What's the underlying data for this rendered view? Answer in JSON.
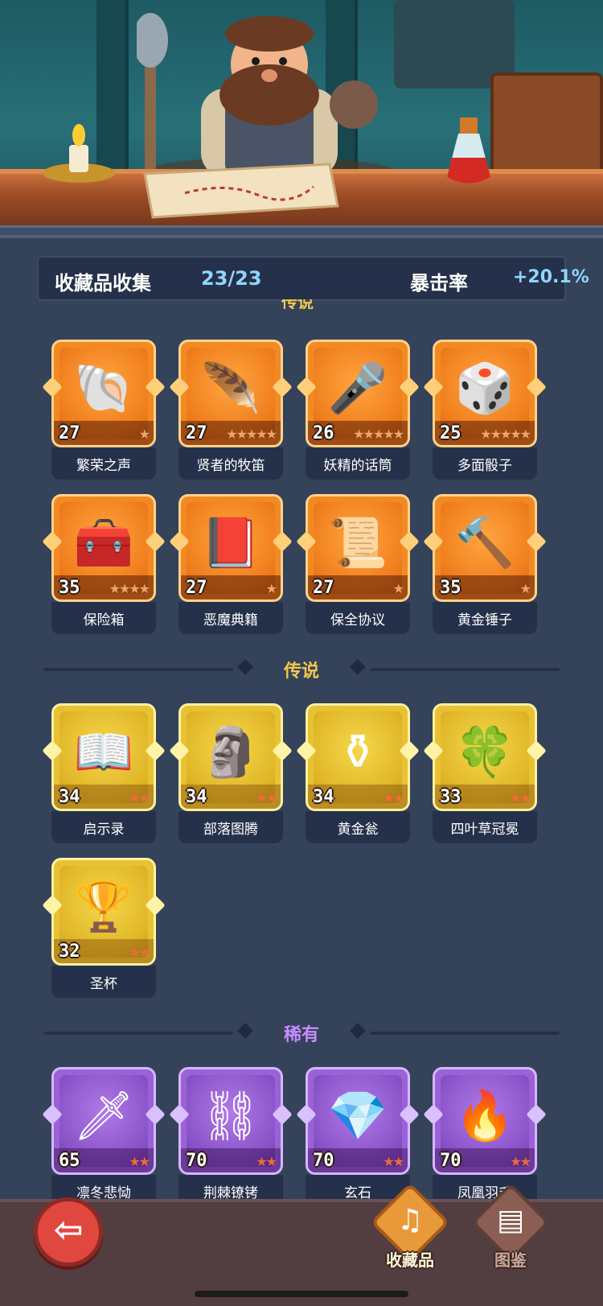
{
  "header": {
    "collection_label": "收藏品收集",
    "collection_count": "23/23",
    "crit_label": "暴击率",
    "crit_value": "+20.1%",
    "cut_section_title": "传说"
  },
  "sections": [
    {
      "title": "",
      "tier": "orange",
      "items": [
        {
          "name": "繁荣之声",
          "level": "27",
          "stars": "★",
          "icon": "shell-icon"
        },
        {
          "name": "贤者的牧笛",
          "level": "27",
          "stars": "★★★★★",
          "icon": "flute-icon"
        },
        {
          "name": "妖精的话筒",
          "level": "26",
          "stars": "★★★★★",
          "icon": "microphone-icon"
        },
        {
          "name": "多面骰子",
          "level": "25",
          "stars": "★★★★★",
          "icon": "dice-icon"
        },
        {
          "name": "保险箱",
          "level": "35",
          "stars": "★★★★",
          "icon": "treasure-chest-icon"
        },
        {
          "name": "恶魔典籍",
          "level": "27",
          "stars": "★",
          "icon": "demon-book-icon"
        },
        {
          "name": "保全协议",
          "level": "27",
          "stars": "★",
          "icon": "contract-icon"
        },
        {
          "name": "黄金锤子",
          "level": "35",
          "stars": "★",
          "icon": "hammer-icon"
        }
      ]
    },
    {
      "title": "传说",
      "title_color": "#f2c94c",
      "tier": "gold",
      "items": [
        {
          "name": "启示录",
          "level": "34",
          "stars": "★★",
          "icon": "open-book-icon"
        },
        {
          "name": "部落图腾",
          "level": "34",
          "stars": "★★",
          "icon": "totem-icon"
        },
        {
          "name": "黄金瓮",
          "level": "34",
          "stars": "★★",
          "icon": "urn-icon"
        },
        {
          "name": "四叶草冠冕",
          "level": "33",
          "stars": "★★",
          "icon": "clover-crown-icon"
        },
        {
          "name": "圣杯",
          "level": "32",
          "stars": "★★",
          "icon": "grail-icon"
        }
      ]
    },
    {
      "title": "稀有",
      "title_color": "#c58cff",
      "tier": "purple",
      "items": [
        {
          "name": "凛冬悲恸",
          "level": "65",
          "stars": "★★",
          "icon": "ice-sword-icon"
        },
        {
          "name": "荆棘镣铐",
          "level": "70",
          "stars": "★★",
          "icon": "thorn-shackle-icon"
        },
        {
          "name": "玄石",
          "level": "70",
          "stars": "★★",
          "icon": "rune-stone-icon"
        },
        {
          "name": "凤凰羽毛",
          "level": "70",
          "stars": "★★",
          "icon": "phoenix-feather-icon"
        }
      ]
    }
  ],
  "bottom_nav": {
    "back_icon": "back-arrow-icon",
    "collectibles_label": "收藏品",
    "codex_label": "图鉴"
  }
}
